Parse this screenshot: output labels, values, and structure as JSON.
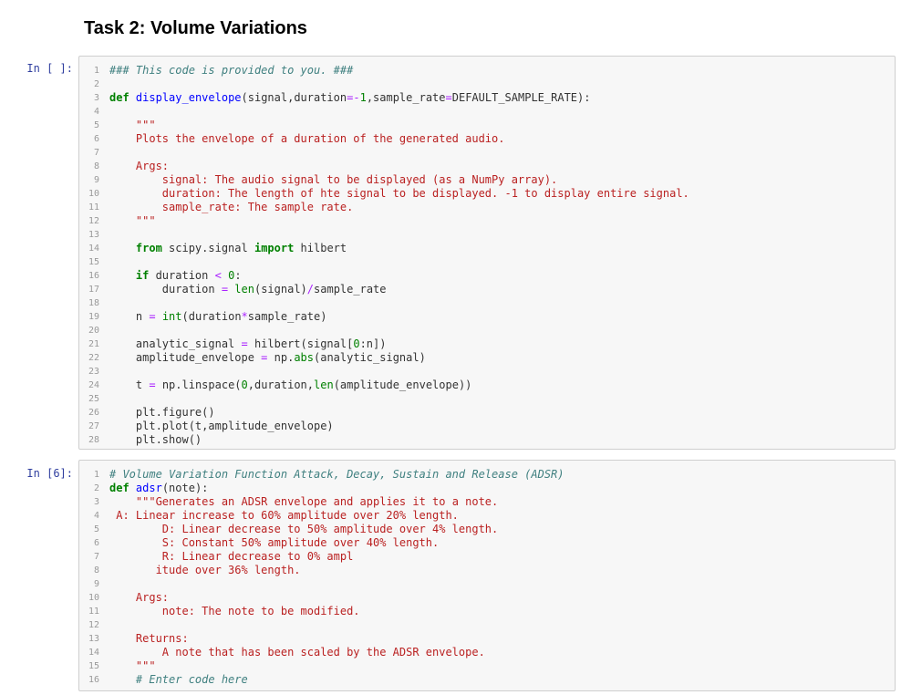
{
  "heading": "Task 2: Volume Variations",
  "cells": [
    {
      "prompt": "In [ ]:",
      "lines": [
        "### This code is provided to you. ###",
        "",
        "def display_envelope(signal,duration=-1,sample_rate=DEFAULT_SAMPLE_RATE):",
        "",
        "    \"\"\"",
        "    Plots the envelope of a duration of the generated audio.",
        "",
        "    Args:",
        "        signal: The audio signal to be displayed (as a NumPy array).",
        "        duration: The length of hte signal to be displayed. -1 to display entire signal.",
        "        sample_rate: The sample rate.",
        "    \"\"\"",
        "",
        "    from scipy.signal import hilbert",
        "",
        "    if duration < 0:",
        "        duration = len(signal)/sample_rate",
        "",
        "    n = int(duration*sample_rate)",
        "",
        "    analytic_signal = hilbert(signal[0:n])",
        "    amplitude_envelope = np.abs(analytic_signal)",
        "",
        "    t = np.linspace(0,duration,len(amplitude_envelope))",
        "",
        "    plt.figure()",
        "    plt.plot(t,amplitude_envelope)",
        "    plt.show()"
      ]
    },
    {
      "prompt": "In [6]:",
      "lines": [
        "# Volume Variation Function Attack, Decay, Sustain and Release (ADSR)",
        "def adsr(note):",
        "    \"\"\"Generates an ADSR envelope and applies it to a note.",
        " A: Linear increase to 60% amplitude over 20% length.",
        "        D: Linear decrease to 50% amplitude over 4% length.",
        "        S: Constant 50% amplitude over 40% length.",
        "        R: Linear decrease to 0% ampl",
        "       itude over 36% length.",
        "",
        "    Args:",
        "        note: The note to be modified.",
        "",
        "    Returns:",
        "        A note that has been scaled by the ADSR envelope.",
        "    \"\"\"",
        "    # Enter code here"
      ]
    }
  ]
}
